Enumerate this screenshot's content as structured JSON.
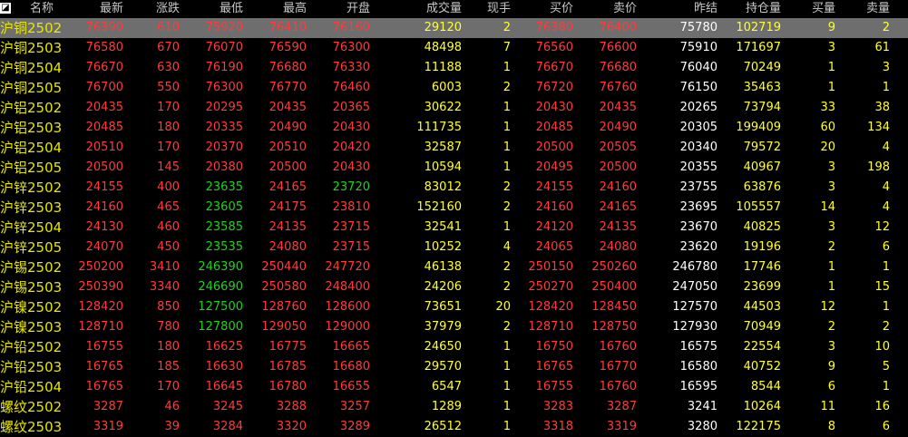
{
  "headers": [
    "名称",
    "最新",
    "涨跌",
    "最低",
    "最高",
    "开盘",
    "成交量",
    "现手",
    "买价",
    "卖价",
    "昨结",
    "持仓量",
    "买量",
    "卖量"
  ],
  "corner_icon": "grid-corner",
  "rows": [
    {
      "name": "沪铜2502",
      "last": "76390",
      "chg": "610",
      "low": "75920",
      "high": "76410",
      "open": "76160",
      "vol": "29120",
      "cur": "2",
      "bid": "76380",
      "ask": "76400",
      "prev": "75780",
      "oi": "102719",
      "bidv": "9",
      "askv": "2",
      "low_color": "red",
      "open_color": "red"
    },
    {
      "name": "沪铜2503",
      "last": "76580",
      "chg": "670",
      "low": "76070",
      "high": "76590",
      "open": "76300",
      "vol": "48498",
      "cur": "7",
      "bid": "76560",
      "ask": "76600",
      "prev": "75910",
      "oi": "171697",
      "bidv": "3",
      "askv": "61",
      "low_color": "red",
      "open_color": "red"
    },
    {
      "name": "沪铜2504",
      "last": "76670",
      "chg": "630",
      "low": "76190",
      "high": "76680",
      "open": "76330",
      "vol": "11188",
      "cur": "1",
      "bid": "76670",
      "ask": "76680",
      "prev": "76040",
      "oi": "70249",
      "bidv": "1",
      "askv": "3",
      "low_color": "red",
      "open_color": "red"
    },
    {
      "name": "沪铜2505",
      "last": "76700",
      "chg": "550",
      "low": "76300",
      "high": "76770",
      "open": "76460",
      "vol": "6003",
      "cur": "2",
      "bid": "76720",
      "ask": "76760",
      "prev": "76150",
      "oi": "35463",
      "bidv": "1",
      "askv": "1",
      "low_color": "red",
      "open_color": "red"
    },
    {
      "name": "沪铝2502",
      "last": "20435",
      "chg": "170",
      "low": "20295",
      "high": "20435",
      "open": "20365",
      "vol": "30622",
      "cur": "1",
      "bid": "20430",
      "ask": "20435",
      "prev": "20265",
      "oi": "73794",
      "bidv": "33",
      "askv": "38",
      "low_color": "red",
      "open_color": "red"
    },
    {
      "name": "沪铝2503",
      "last": "20485",
      "chg": "180",
      "low": "20335",
      "high": "20490",
      "open": "20430",
      "vol": "111735",
      "cur": "1",
      "bid": "20485",
      "ask": "20490",
      "prev": "20305",
      "oi": "199409",
      "bidv": "60",
      "askv": "134",
      "low_color": "red",
      "open_color": "red"
    },
    {
      "name": "沪铝2504",
      "last": "20510",
      "chg": "170",
      "low": "20370",
      "high": "20510",
      "open": "20420",
      "vol": "32587",
      "cur": "1",
      "bid": "20500",
      "ask": "20505",
      "prev": "20340",
      "oi": "79572",
      "bidv": "20",
      "askv": "4",
      "low_color": "red",
      "open_color": "red"
    },
    {
      "name": "沪铝2505",
      "last": "20500",
      "chg": "145",
      "low": "20380",
      "high": "20500",
      "open": "20430",
      "vol": "10594",
      "cur": "1",
      "bid": "20495",
      "ask": "20500",
      "prev": "20355",
      "oi": "40967",
      "bidv": "3",
      "askv": "198",
      "low_color": "red",
      "open_color": "red"
    },
    {
      "name": "沪锌2502",
      "last": "24155",
      "chg": "400",
      "low": "23635",
      "high": "24165",
      "open": "23720",
      "vol": "83012",
      "cur": "2",
      "bid": "24155",
      "ask": "24160",
      "prev": "23755",
      "oi": "63876",
      "bidv": "3",
      "askv": "4",
      "low_color": "green",
      "open_color": "green"
    },
    {
      "name": "沪锌2503",
      "last": "24160",
      "chg": "465",
      "low": "23605",
      "high": "24175",
      "open": "23810",
      "vol": "152160",
      "cur": "2",
      "bid": "24160",
      "ask": "24165",
      "prev": "23695",
      "oi": "105557",
      "bidv": "14",
      "askv": "4",
      "low_color": "green",
      "open_color": "red"
    },
    {
      "name": "沪锌2504",
      "last": "24130",
      "chg": "460",
      "low": "23585",
      "high": "24135",
      "open": "23715",
      "vol": "32541",
      "cur": "1",
      "bid": "24120",
      "ask": "24135",
      "prev": "23670",
      "oi": "40825",
      "bidv": "3",
      "askv": "12",
      "low_color": "green",
      "open_color": "red"
    },
    {
      "name": "沪锌2505",
      "last": "24070",
      "chg": "450",
      "low": "23535",
      "high": "24080",
      "open": "23715",
      "vol": "10252",
      "cur": "4",
      "bid": "24065",
      "ask": "24080",
      "prev": "23620",
      "oi": "19196",
      "bidv": "2",
      "askv": "6",
      "low_color": "green",
      "open_color": "red"
    },
    {
      "name": "沪锡2502",
      "last": "250200",
      "chg": "3410",
      "low": "246390",
      "high": "250440",
      "open": "247720",
      "vol": "46138",
      "cur": "2",
      "bid": "250150",
      "ask": "250260",
      "prev": "246780",
      "oi": "17746",
      "bidv": "1",
      "askv": "1",
      "low_color": "green",
      "open_color": "red"
    },
    {
      "name": "沪锡2503",
      "last": "250390",
      "chg": "3340",
      "low": "246690",
      "high": "250580",
      "open": "248400",
      "vol": "24206",
      "cur": "2",
      "bid": "250270",
      "ask": "250400",
      "prev": "247050",
      "oi": "23699",
      "bidv": "1",
      "askv": "15",
      "low_color": "green",
      "open_color": "red"
    },
    {
      "name": "沪镍2502",
      "last": "128420",
      "chg": "850",
      "low": "127500",
      "high": "128760",
      "open": "128600",
      "vol": "73651",
      "cur": "20",
      "bid": "128420",
      "ask": "128450",
      "prev": "127570",
      "oi": "44503",
      "bidv": "12",
      "askv": "1",
      "low_color": "green",
      "open_color": "red"
    },
    {
      "name": "沪镍2503",
      "last": "128710",
      "chg": "780",
      "low": "127800",
      "high": "129050",
      "open": "129000",
      "vol": "37979",
      "cur": "2",
      "bid": "128710",
      "ask": "128750",
      "prev": "127930",
      "oi": "70949",
      "bidv": "2",
      "askv": "2",
      "low_color": "green",
      "open_color": "red"
    },
    {
      "name": "沪铅2502",
      "last": "16755",
      "chg": "180",
      "low": "16625",
      "high": "16775",
      "open": "16665",
      "vol": "24650",
      "cur": "1",
      "bid": "16750",
      "ask": "16760",
      "prev": "16575",
      "oi": "22554",
      "bidv": "3",
      "askv": "10",
      "low_color": "red",
      "open_color": "red"
    },
    {
      "name": "沪铅2503",
      "last": "16765",
      "chg": "185",
      "low": "16630",
      "high": "16785",
      "open": "16680",
      "vol": "29570",
      "cur": "1",
      "bid": "16765",
      "ask": "16770",
      "prev": "16580",
      "oi": "40752",
      "bidv": "9",
      "askv": "5",
      "low_color": "red",
      "open_color": "red"
    },
    {
      "name": "沪铅2504",
      "last": "16765",
      "chg": "170",
      "low": "16645",
      "high": "16780",
      "open": "16655",
      "vol": "6547",
      "cur": "1",
      "bid": "16755",
      "ask": "16760",
      "prev": "16595",
      "oi": "8544",
      "bidv": "6",
      "askv": "1",
      "low_color": "red",
      "open_color": "red"
    },
    {
      "name": "螺纹2502",
      "last": "3287",
      "chg": "46",
      "low": "3245",
      "high": "3288",
      "open": "3257",
      "vol": "1289",
      "cur": "1",
      "bid": "3283",
      "ask": "3287",
      "prev": "3241",
      "oi": "10264",
      "bidv": "11",
      "askv": "16",
      "low_color": "red",
      "open_color": "red"
    },
    {
      "name": "螺纹2503",
      "last": "3319",
      "chg": "39",
      "low": "3284",
      "high": "3320",
      "open": "3289",
      "vol": "26512",
      "cur": "1",
      "bid": "3318",
      "ask": "3319",
      "prev": "3280",
      "oi": "122175",
      "bidv": "8",
      "askv": "6",
      "low_color": "red",
      "open_color": "red"
    }
  ],
  "colors": {
    "up": "#ff3b3b",
    "down": "#20d020",
    "volume": "#ffff33",
    "name": "#e6e600",
    "header": "#c8c8c8",
    "selected_bg": "#6e6e6e"
  }
}
